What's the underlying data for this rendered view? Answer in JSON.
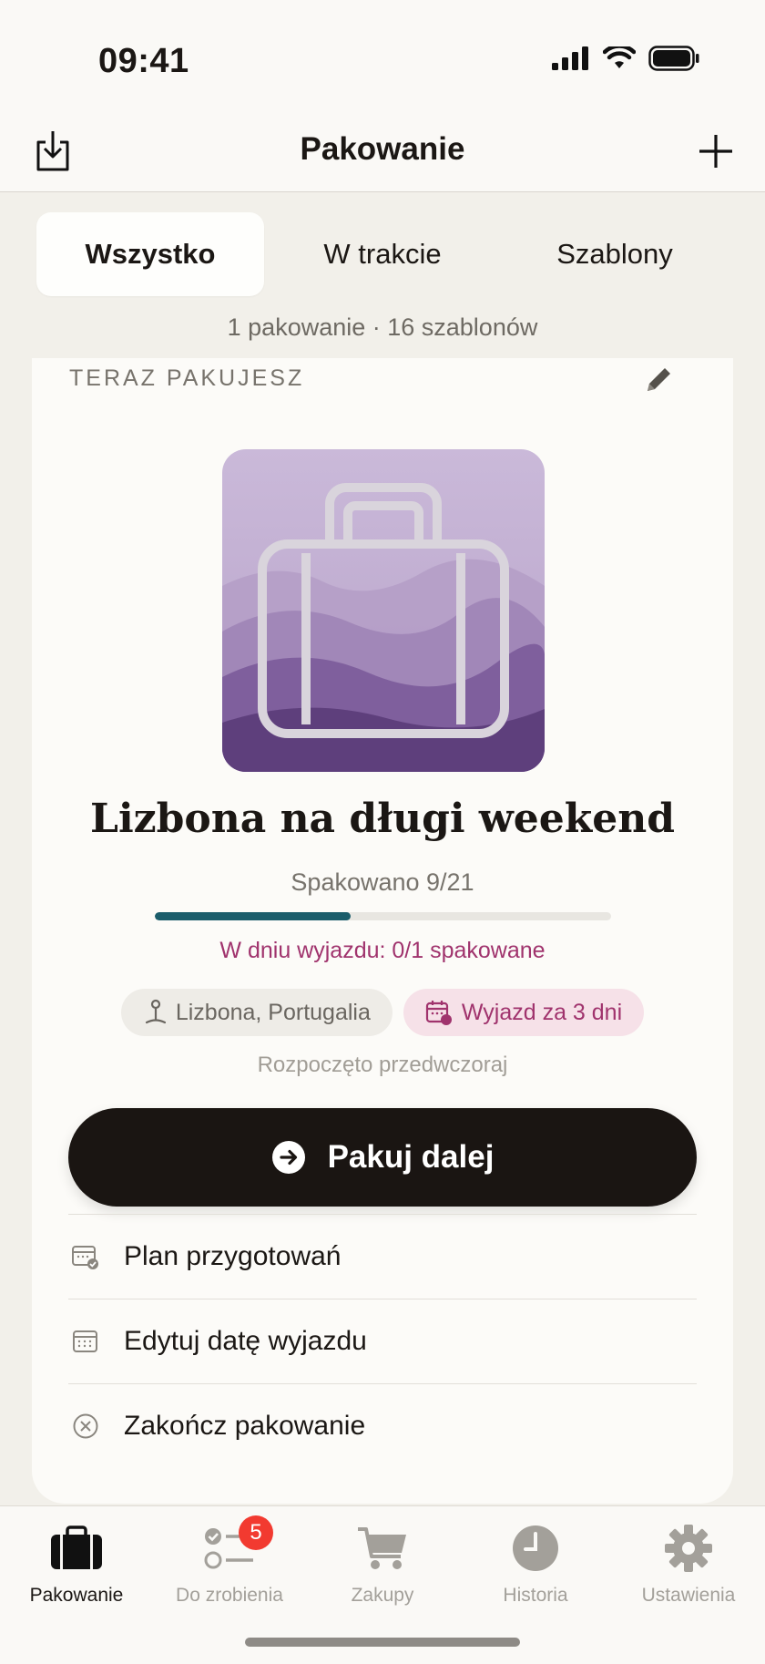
{
  "status_bar": {
    "time": "09:41"
  },
  "nav": {
    "title": "Pakowanie",
    "left_icon": "download-icon",
    "right_icon": "plus-icon"
  },
  "segments": {
    "items": [
      "Wszystko",
      "W trakcie",
      "Szablony"
    ],
    "selected": "Wszystko"
  },
  "summary": "1 pakowanie · 16 szablonów",
  "card": {
    "section_label": "TERAZ PAKUJESZ",
    "trip_title": "Lizbona na długi weekend",
    "packed_text": "Spakowano 9/21",
    "progress": {
      "packed": 9,
      "total": 21
    },
    "departure_status": "W dniu wyjazdu: 0/1 spakowane",
    "location_chip": "Lizbona, Portugalia",
    "departure_chip": "Wyjazd za 3 dni",
    "started_text": "Rozpoczęto przedwczoraj",
    "primary_button": "Pakuj dalej",
    "actions": [
      {
        "label": "Plan przygotowań",
        "icon": "calendar-check-icon"
      },
      {
        "label": "Edytuj datę wyjazdu",
        "icon": "calendar-icon"
      },
      {
        "label": "Zakończ pakowanie",
        "icon": "close-circle-icon"
      }
    ]
  },
  "tabs": [
    {
      "label": "Pakowanie",
      "icon": "suitcase-icon",
      "active": true
    },
    {
      "label": "Do zrobienia",
      "icon": "checklist-icon",
      "badge": "5"
    },
    {
      "label": "Zakupy",
      "icon": "cart-icon"
    },
    {
      "label": "Historia",
      "icon": "clock-icon"
    },
    {
      "label": "Ustawienia",
      "icon": "gear-icon"
    }
  ],
  "colors": {
    "accent": "#1b5d6b",
    "departure": "#a0336d",
    "badge": "#f23a30",
    "primary_button": "#1a1512"
  }
}
